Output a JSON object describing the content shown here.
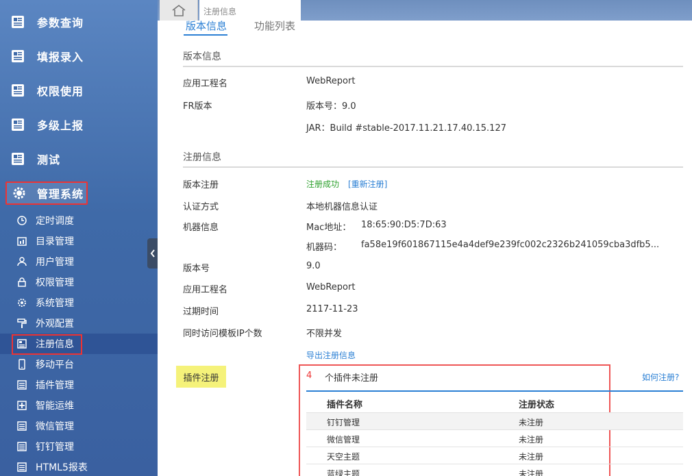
{
  "sidebar": {
    "top_items": [
      {
        "label": "参数查询",
        "icon": "document-icon"
      },
      {
        "label": "填报录入",
        "icon": "document-icon"
      },
      {
        "label": "权限使用",
        "icon": "document-icon"
      },
      {
        "label": "多级上报",
        "icon": "document-icon"
      },
      {
        "label": "测试",
        "icon": "document-icon"
      }
    ],
    "active_top": {
      "label": "管理系统",
      "icon": "gear-icon"
    },
    "sub_items": [
      {
        "label": "定时调度",
        "icon": "clock-icon"
      },
      {
        "label": "目录管理",
        "icon": "directory-icon"
      },
      {
        "label": "用户管理",
        "icon": "user-icon"
      },
      {
        "label": "权限管理",
        "icon": "lock-icon"
      },
      {
        "label": "系统管理",
        "icon": "gear-icon"
      },
      {
        "label": "外观配置",
        "icon": "paint-roller-icon"
      },
      {
        "label": "注册信息",
        "icon": "register-icon",
        "selected": true
      },
      {
        "label": "移动平台",
        "icon": "mobile-icon"
      },
      {
        "label": "插件管理",
        "icon": "list-icon"
      },
      {
        "label": "智能运维",
        "icon": "plus-box-icon"
      },
      {
        "label": "微信管理",
        "icon": "list-icon"
      },
      {
        "label": "钉钉管理",
        "icon": "list-icon"
      },
      {
        "label": "HTML5报表",
        "icon": "list-icon"
      }
    ]
  },
  "tabs": {
    "home_icon": "home-icon",
    "page_tab": "注册信息"
  },
  "subtabs": {
    "active": "版本信息",
    "inactive": "功能列表"
  },
  "version_section": {
    "title": "版本信息",
    "app_name_label": "应用工程名",
    "app_name_value": "WebReport",
    "fr_label": "FR版本",
    "fr_value": "版本号：9.0",
    "jar_value": "JAR：Build #stable-2017.11.21.17.40.15.127"
  },
  "register_section": {
    "title": "注册信息",
    "version_reg_label": "版本注册",
    "reg_status": "注册成功",
    "reregister": "[重新注册]",
    "auth_label": "认证方式",
    "auth_value": "本地机器信息认证",
    "machine_label": "机器信息",
    "mac_label": "Mac地址：",
    "mac_value": "18:65:90:D5:7D:63",
    "code_label": "机器码：",
    "code_value": "fa58e19f601867115e4a4def9e239fc002c2326b241059cba3dfb5...",
    "version_label": "版本号",
    "version_value": "9.0",
    "app_label": "应用工程名",
    "app_value": "WebReport",
    "expire_label": "过期时间",
    "expire_value": "2117-11-23",
    "concurrency_label": "同时访问模板IP个数",
    "concurrency_value": "不限并发",
    "export_link": "导出注册信息"
  },
  "plugin_section": {
    "label": "插件注册",
    "count": "4",
    "count_text": "个插件未注册",
    "how_link": "如何注册?",
    "headers": [
      "插件名称",
      "注册状态"
    ],
    "rows": [
      {
        "name": "钉钉管理",
        "status": "未注册"
      },
      {
        "name": "微信管理",
        "status": "未注册"
      },
      {
        "name": "天空主题",
        "status": "未注册"
      },
      {
        "name": "蓝绿主题",
        "status": "未注册"
      }
    ]
  },
  "colors": {
    "accent": "#2a7fd4",
    "success": "#2ca02c",
    "highlight_border": "#e33",
    "plugin_label_bg": "#f5f27a"
  }
}
